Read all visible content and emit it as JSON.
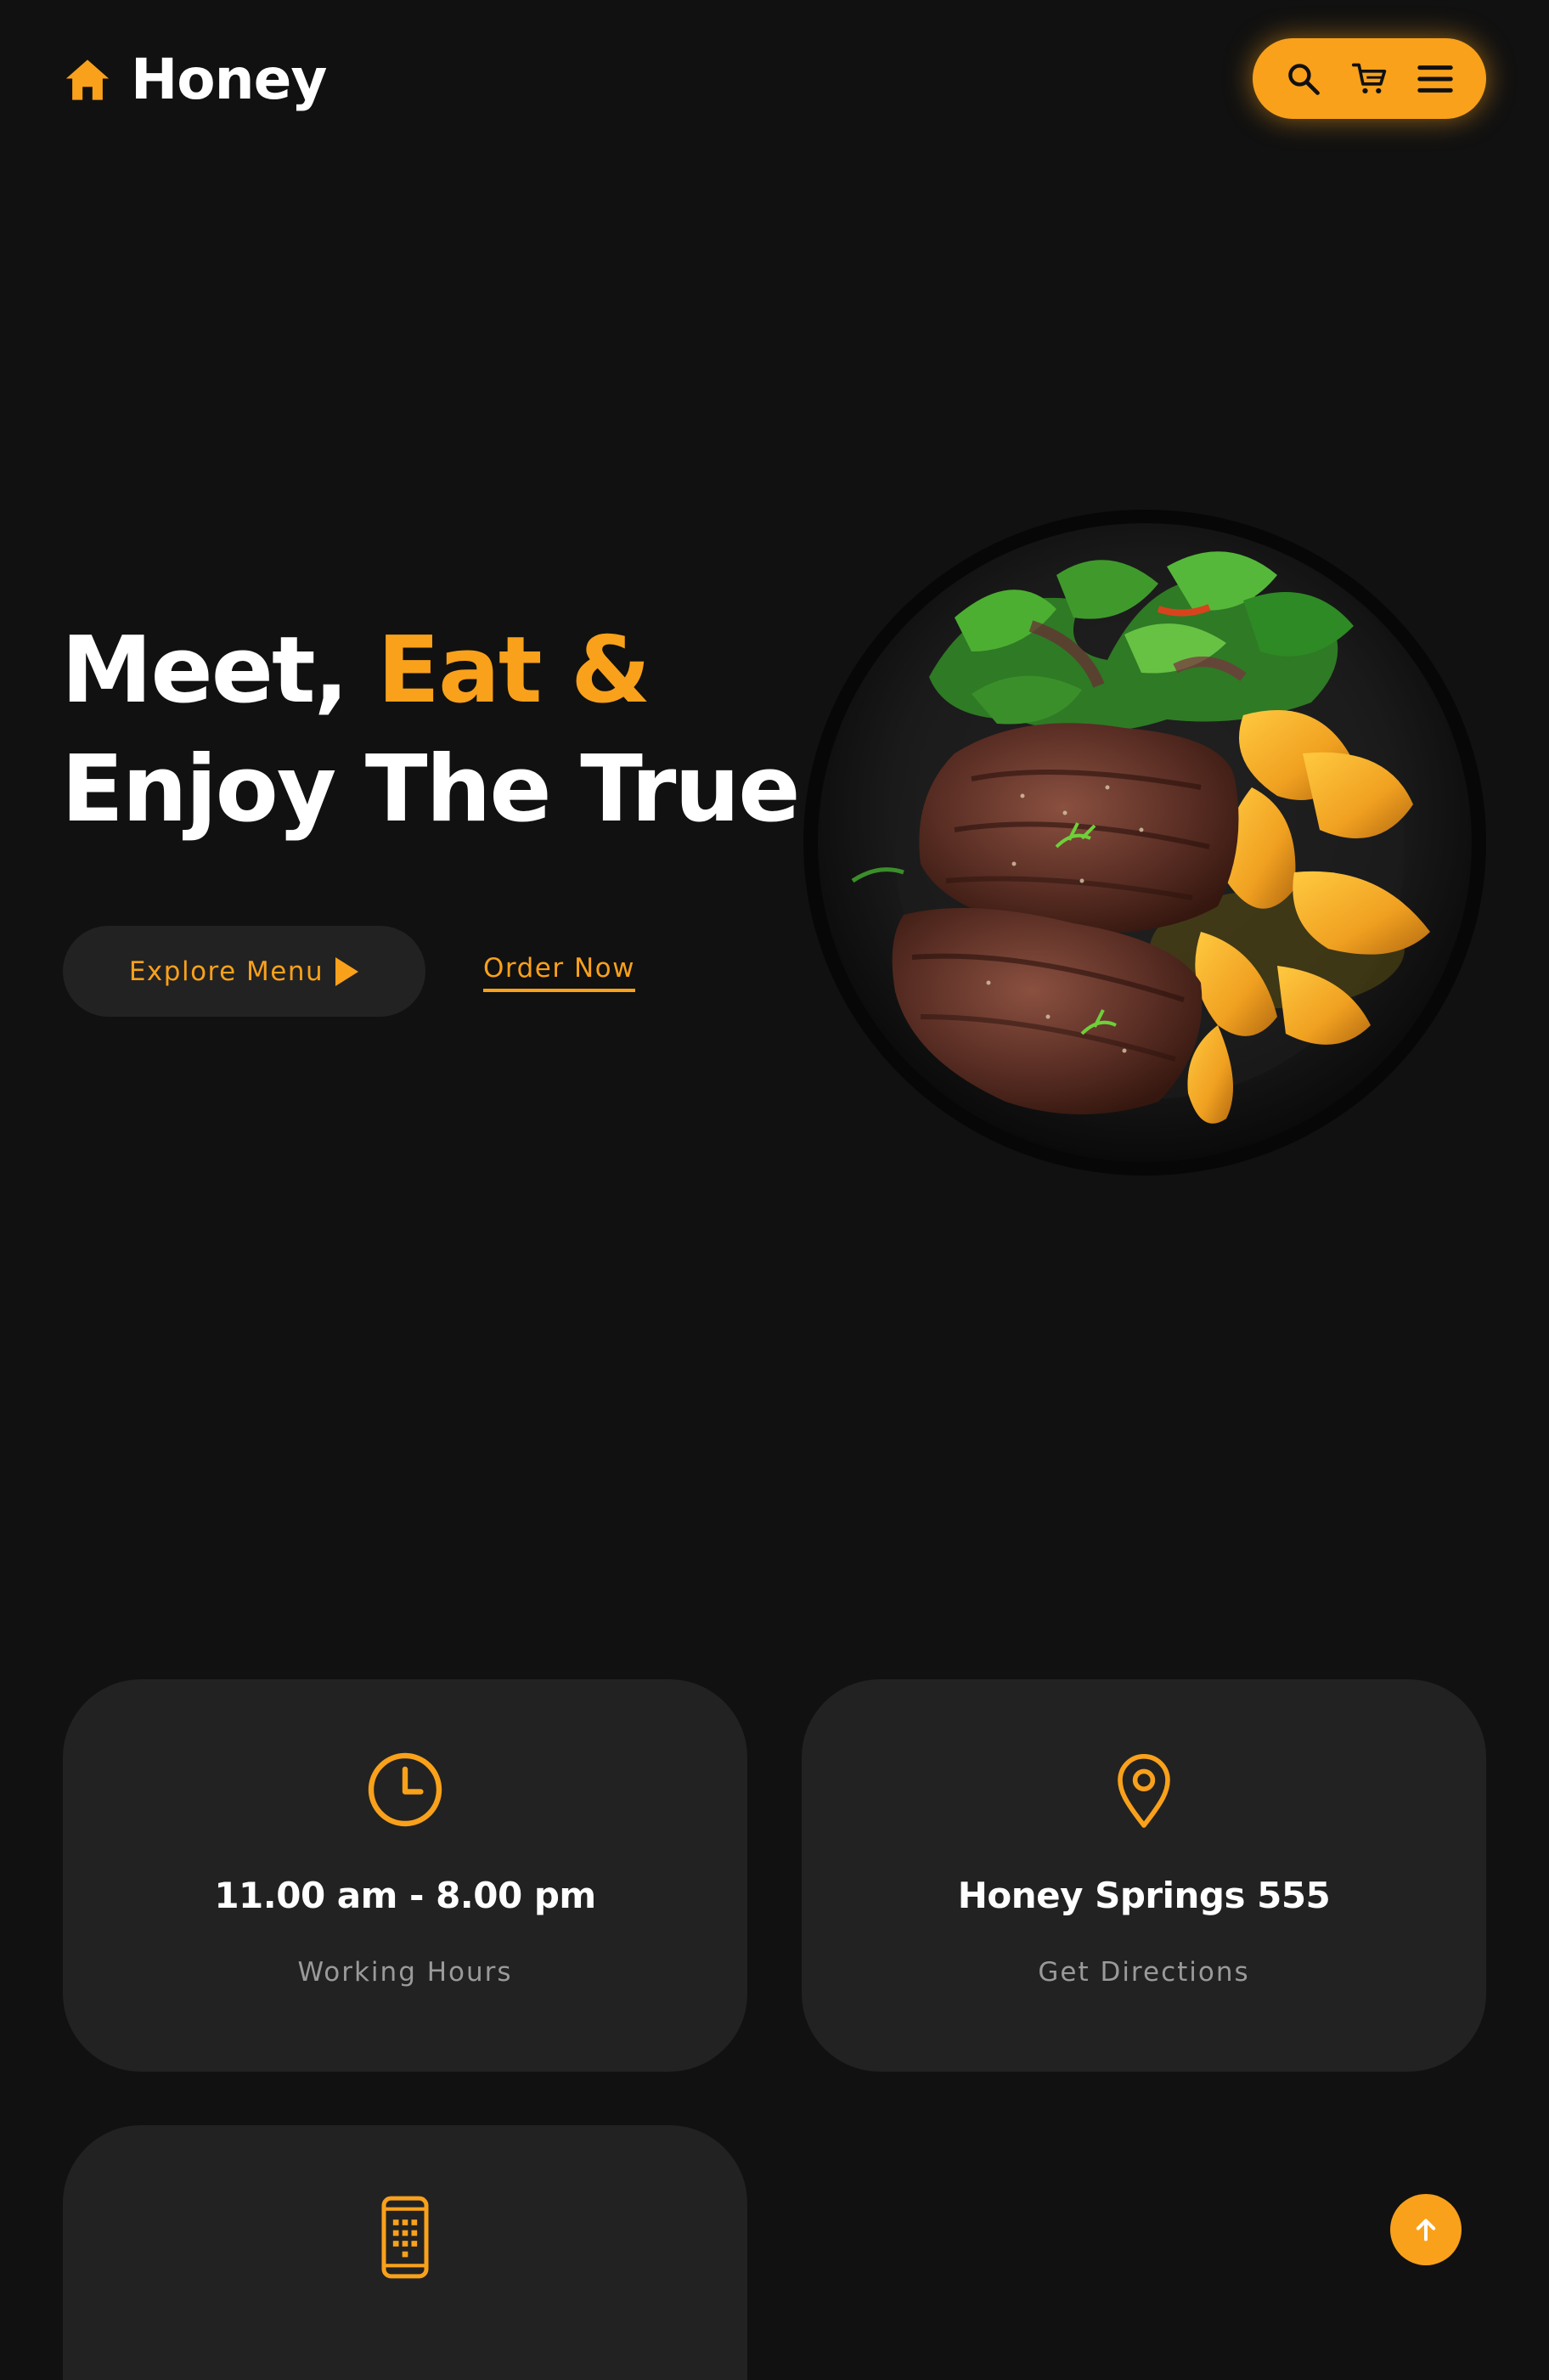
{
  "brand": {
    "name": "Honey",
    "logo_icon": "house-icon",
    "accent_color": "#f9a11b",
    "background_color": "#111111",
    "card_color": "#222222"
  },
  "header": {
    "actions": [
      {
        "icon": "search-icon"
      },
      {
        "icon": "cart-icon"
      },
      {
        "icon": "menu-icon"
      }
    ]
  },
  "hero": {
    "title_part1": "Meet, ",
    "title_accent": "Eat &",
    "title_line2": "Enjoy The True",
    "explore_label": "Explore Menu",
    "explore_icon": "play-arrow-icon",
    "order_label": "Order Now",
    "image": "steak-plate-illustration"
  },
  "info_cards": [
    {
      "icon": "clock-icon",
      "title": "11.00 am - 8.00 pm",
      "subtitle": "Working Hours"
    },
    {
      "icon": "map-pin-icon",
      "title": "Honey Springs 555",
      "subtitle": "Get Directions"
    },
    {
      "icon": "phone-icon"
    }
  ],
  "scroll_top": {
    "icon": "arrow-up-icon"
  }
}
